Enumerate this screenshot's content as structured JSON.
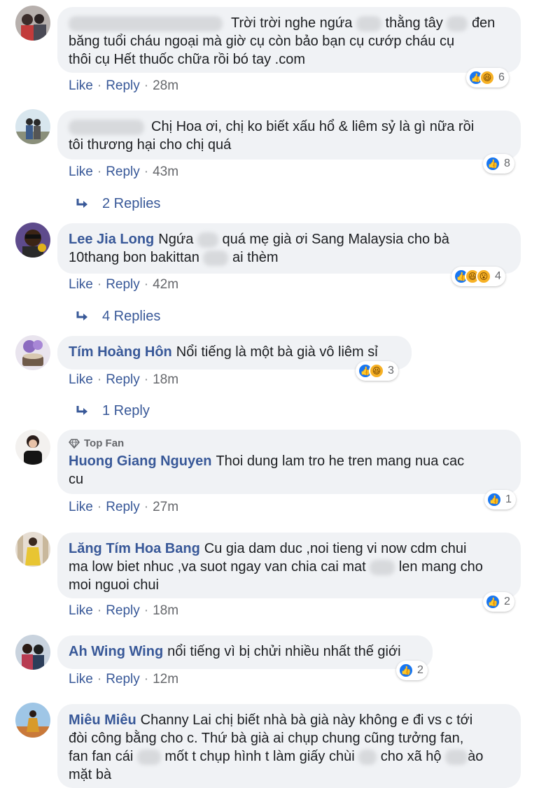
{
  "actions": {
    "like": "Like",
    "reply": "Reply"
  },
  "comments": [
    {
      "name": "",
      "text": "Trời trời nghe ngứa … thằng tây … đen băng tuổi cháu ngoại mà giờ cụ còn bảo bạn cụ cướp cháu cụ thôi cụ Hết thuốc chữa rồi bó tay .com",
      "part1": "Trời trời nghe ngứa",
      "part2": "thằng tây",
      "part3": "đen",
      "line2": "băng tuổi cháu ngoại mà giờ cụ còn bảo bạn cụ cướp cháu cụ",
      "line3": "thôi cụ Hết thuốc chữa rồi bó tay .com",
      "time": "28m",
      "reaction_count": "6",
      "reactions": [
        "like-icon",
        "haha-icon"
      ]
    },
    {
      "name": "",
      "line1": "Chị Hoa ơi, chị ko biết xấu hổ & liêm sỷ là gì nữa rồi",
      "line2": "tôi thương hại cho chị quá",
      "time": "43m",
      "reaction_count": "8",
      "replies": "2 Replies"
    },
    {
      "name": "Lee Jia Long",
      "part1": "Ngứa",
      "part2": "quá mẹ già ơi Sang Malaysia cho bà",
      "line2a": "10thang bon bakittan",
      "line2b": "ai thèm",
      "time": "42m",
      "reaction_count": "4",
      "replies": "4 Replies"
    },
    {
      "name": "Tím Hoàng Hôn",
      "text": "Nổi tiếng là một bà già vô liêm sỉ",
      "time": "18m",
      "reaction_count": "3",
      "replies": "1 Reply"
    },
    {
      "badge": "Top Fan",
      "name": "Huong Giang Nguyen",
      "line1": "Thoi dung lam tro he tren mang nua cac",
      "line2": "cu",
      "time": "27m",
      "reaction_count": "1"
    },
    {
      "name": "Lăng Tím Hoa Bang",
      "line1": "Cu gia dam duc ,noi tieng vi now cdm chui",
      "line2a": "ma low biet nhuc ,va suot ngay van chia cai mat",
      "line2b": "len mang cho",
      "line3": "moi nguoi chui",
      "time": "18m",
      "reaction_count": "2"
    },
    {
      "name": "Ah Wing Wing",
      "text": "nổi tiếng vì bị chửi nhiều nhất thế giới",
      "time": "12m",
      "reaction_count": "2"
    },
    {
      "name": "Miêu Miêu",
      "line1": "Channy Lai chị biết nhà bà già này không e đi vs c tới",
      "line2": "đòi công bằng cho c. Thứ bà già ai chụp chung cũng tưởng fan,",
      "line3a": "fan fan cái",
      "line3b": "mốt t chụp hình t làm giấy chùi",
      "line3c": "cho xã hộ",
      "line3d": "ào",
      "line4": "mặt bà"
    }
  ],
  "colors": {
    "name": "#385898",
    "bubble": "#f0f2f5",
    "like": "#1877f2",
    "haha": "#f7b125"
  }
}
